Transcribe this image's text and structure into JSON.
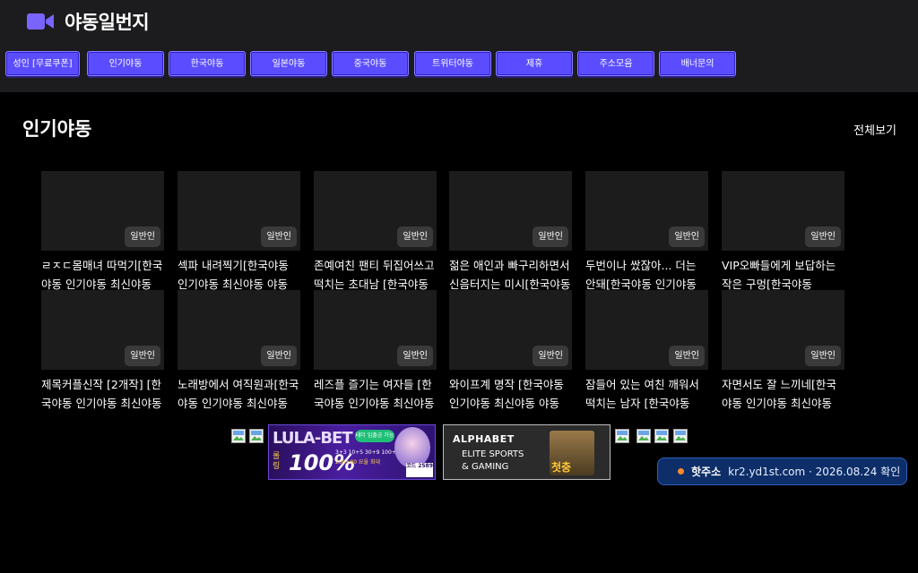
{
  "site": {
    "title": "야동일번지"
  },
  "nav": [
    {
      "label": "성인 [무료쿠폰]"
    },
    {
      "label": "인기야동"
    },
    {
      "label": "한국야동"
    },
    {
      "label": "일본야동"
    },
    {
      "label": "중국야동"
    },
    {
      "label": "트위터야동"
    },
    {
      "label": "제휴"
    },
    {
      "label": "주소모음"
    },
    {
      "label": "배너문의"
    }
  ],
  "section": {
    "title": "인기야동",
    "see_all": "전체보기"
  },
  "videos": [
    {
      "title": "ㄹㅈㄷ몸매녀 따먹기[한국야동 인기야동 최신야동",
      "badge": "일반인"
    },
    {
      "title": "섹파 내려찍기[한국야동 인기야동 최신야동 야동",
      "badge": "일반인"
    },
    {
      "title": "존예여친 팬티 뒤집어쓰고 떡치는 초대남 [한국야동",
      "badge": "일반인"
    },
    {
      "title": "젊은 애인과 빠구리하면서 신음터지는 미시[한국야동",
      "badge": "일반인"
    },
    {
      "title": "두번이나 쌌잖아... 더는 안돼[한국야동 인기야동",
      "badge": "일반인"
    },
    {
      "title": "VIP오빠들에게 보답하는 작은 구멍[한국야동",
      "badge": "일반인"
    },
    {
      "title": "제목커플신작 [2개작] [한국야동 인기야동 최신야동",
      "badge": "일반인"
    },
    {
      "title": "노래방에서 여직원과[한국야동 인기야동 최신야동",
      "badge": "일반인"
    },
    {
      "title": "레즈플 즐기는 여자들 [한국야동 인기야동 최신야동",
      "badge": "일반인"
    },
    {
      "title": "와이프계 명작 [한국야동 인기야동 최신야동 야동",
      "badge": "일반인"
    },
    {
      "title": "잠들어 있는 여친 깨워서 떡치는 남자 [한국야동",
      "badge": "일반인"
    },
    {
      "title": "자면서도 잘 느끼네[한국야동 인기야동 최신야동",
      "badge": "일반인"
    }
  ],
  "banners": {
    "b1": {
      "brand": "LULA-BET",
      "big": "100%",
      "side": "롤링",
      "pill": "테더 입출금 가능",
      "line1": "3+3 10+5 30+9 100+40",
      "line2": "200+80 요율 최대",
      "code": "코드 2589"
    },
    "b2": {
      "brand": "ALPHABET",
      "line1": "ELITE SPORTS",
      "line2": "& GAMING",
      "label": "첫충"
    }
  },
  "hot_address": {
    "label": "핫주소",
    "text": "kr2.yd1st.com · 2026.08.24 확인"
  },
  "colors": {
    "accent": "#5b4dff",
    "topbar": "#1c1c1e",
    "background": "#000000",
    "hot_bg": "#0d2e68"
  }
}
